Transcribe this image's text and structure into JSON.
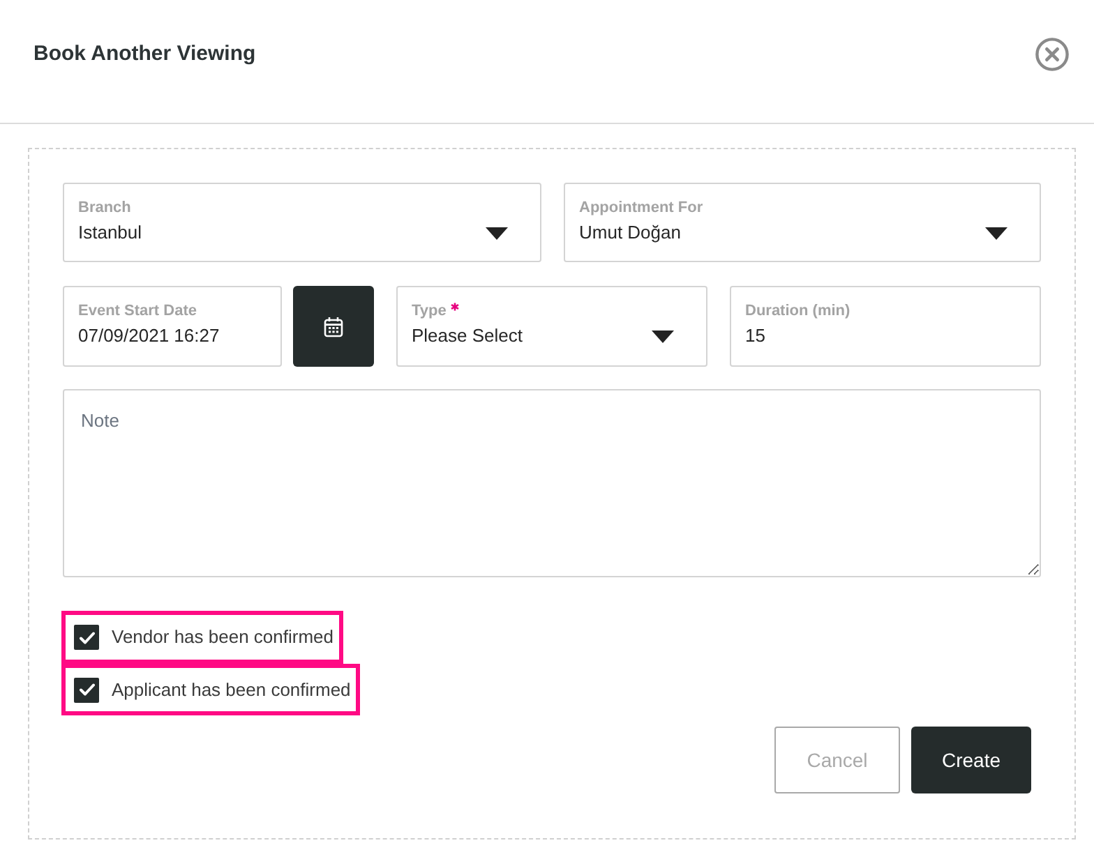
{
  "dialog": {
    "title": "Book Another Viewing"
  },
  "form": {
    "rows": [
      [
        {
          "kind": "select",
          "label": "Branch",
          "value": "Istanbul",
          "required": false
        },
        {
          "kind": "select",
          "label": "Appointment For",
          "value": "Umut Doğan",
          "required": false
        }
      ],
      [
        {
          "kind": "date",
          "label": "Event Start Date",
          "value": "07/09/2021 16:27",
          "required": false
        },
        {
          "kind": "select",
          "label": "Type",
          "value": "Please Select",
          "required": true
        },
        {
          "kind": "text",
          "label": "Duration (min)",
          "value": "15",
          "required": false
        }
      ]
    ]
  },
  "note": {
    "placeholder": "Note"
  },
  "checkboxes": [
    {
      "label": "Vendor has been confirmed",
      "checked": true,
      "highlighted": true
    },
    {
      "label": "Applicant has been confirmed",
      "checked": true,
      "highlighted": true
    }
  ],
  "buttons": [
    {
      "kind": "secondary",
      "label": "Cancel"
    },
    {
      "kind": "primary",
      "label": "Create"
    }
  ]
}
